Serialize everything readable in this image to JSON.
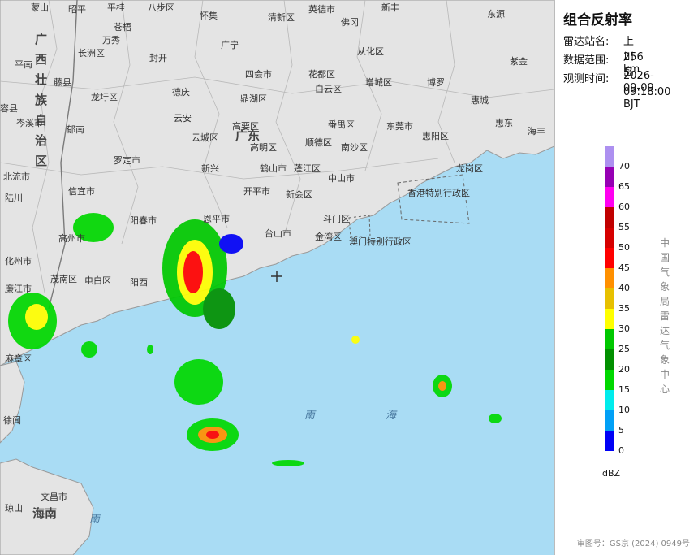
{
  "panel": {
    "title": "组合反射率",
    "station_label": "雷达站名:",
    "station_value": "上川岛",
    "range_label": "数据范围:",
    "range_value": "256 km",
    "time_label": "观测时间:",
    "time_date": "2026-09-09",
    "time_clock": "09:18:00 BJT",
    "unit": "dBZ",
    "org": "中国气象局雷达气象中心",
    "approval": "审图号：GS京 (2024) 0949号"
  },
  "legend": {
    "ticks": [
      "0",
      "5",
      "10",
      "15",
      "20",
      "25",
      "30",
      "35",
      "40",
      "45",
      "50",
      "55",
      "60",
      "65",
      "70"
    ],
    "colors": [
      "#0000f6",
      "#01a0f6",
      "#00ecec",
      "#00d800",
      "#019000",
      "#00c800",
      "#ffff00",
      "#e7c000",
      "#ff9000",
      "#ff0000",
      "#d60000",
      "#c00000",
      "#ff00f0",
      "#9600b4",
      "#ad90f0"
    ]
  },
  "map": {
    "provinces": [
      "广西壮族自治区",
      "广东",
      "海南"
    ],
    "cities": [
      "蒙山",
      "昭平",
      "平桂",
      "八步区",
      "怀集",
      "英德市",
      "新丰",
      "苍梧",
      "万秀",
      "清新区",
      "佛冈",
      "从化区",
      "东源",
      "长洲区",
      "封开",
      "广宁",
      "四会市",
      "花都区",
      "增城区",
      "紫金",
      "藤县",
      "龙圩区",
      "德庆",
      "鼎湖区",
      "白云区",
      "博罗",
      "惠城",
      "岑溪市",
      "郁南",
      "云安",
      "高要区",
      "番禺区",
      "东莞市",
      "惠东",
      "罗定市",
      "云城区",
      "高明区",
      "顺德区",
      "南沙区",
      "惠阳区",
      "新兴",
      "鹤山市",
      "蓬江区",
      "中山市",
      "龙岗区",
      "信宜市",
      "开平市",
      "新会区",
      "阳春市",
      "恩平市",
      "斗门区",
      "台山市",
      "金湾区",
      "高州市",
      "茂南区",
      "电白区",
      "阳西",
      "化州市",
      "廉江市",
      "麻章区",
      "徐闻",
      "平南",
      "容县",
      "北流市",
      "陆川",
      "海丰",
      "香港特别行政区",
      "澳门特别行政区",
      "文昌市",
      "琼山"
    ],
    "seas": [
      "南",
      "海",
      "海",
      "南"
    ]
  }
}
